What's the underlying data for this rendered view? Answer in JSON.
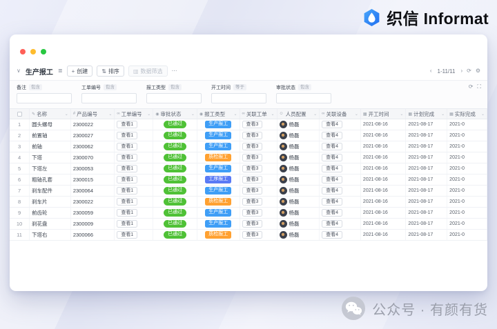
{
  "brand": {
    "name": "织信 Informat"
  },
  "watermark": {
    "text": "公众号 · 有颜有货"
  },
  "colors": {
    "green": "#4fc136",
    "blue": "#3f9ef6",
    "orange": "#ffa131",
    "blue2": "#5a7af5",
    "accent": "#2f86f6"
  },
  "icons": {
    "text": "✎",
    "number": "#",
    "link": "∞",
    "status": "◉",
    "user": "☺",
    "date": "▦"
  },
  "view": {
    "title": "生产报工",
    "toolbar": {
      "create": "创建",
      "sort": "排序",
      "filter": "数据筛选",
      "pagination": "1-11/11"
    },
    "filters": [
      {
        "label": "备注",
        "op": "包含"
      },
      {
        "label": "工单编号",
        "op": "包含"
      },
      {
        "label": "报工类型",
        "op": "包含"
      },
      {
        "label": "开工时间",
        "op": "等于"
      },
      {
        "label": "审批状态",
        "op": "包含"
      }
    ]
  },
  "table": {
    "columns": [
      {
        "key": "name",
        "label": "名称",
        "icon": "text"
      },
      {
        "key": "pno",
        "label": "产品编号",
        "icon": "number"
      },
      {
        "key": "wo",
        "label": "工单编号",
        "icon": "link"
      },
      {
        "key": "appr",
        "label": "审批状态",
        "icon": "status"
      },
      {
        "key": "type",
        "label": "报工类型",
        "icon": "status"
      },
      {
        "key": "rel",
        "label": "关联工单",
        "icon": "link"
      },
      {
        "key": "person",
        "label": "人员配置",
        "icon": "user"
      },
      {
        "key": "equip",
        "label": "关联设备",
        "icon": "link"
      },
      {
        "key": "start",
        "label": "开工时间",
        "icon": "date"
      },
      {
        "key": "plan",
        "label": "计划完成",
        "icon": "date"
      },
      {
        "key": "actual",
        "label": "实际完成",
        "icon": "date"
      }
    ],
    "rows": [
      {
        "num": 1,
        "name": "圆头螺母",
        "product_no": "2300022",
        "work_order": "查看1",
        "approval": "已通过",
        "report_type": "生产报工",
        "report_type_color": "blue",
        "related_order": "查看3",
        "person": "杨磊",
        "equipment": "查看4",
        "start": "2021-08-16",
        "planned": "2021-08-17",
        "actual": "2021-0"
      },
      {
        "num": 2,
        "name": "前置轴",
        "product_no": "2300027",
        "work_order": "查看1",
        "approval": "已通过",
        "report_type": "生产报工",
        "report_type_color": "blue",
        "related_order": "查看3",
        "person": "杨磊",
        "equipment": "查看4",
        "start": "2021-08-16",
        "planned": "2021-08-17",
        "actual": "2021-0"
      },
      {
        "num": 3,
        "name": "前轴",
        "product_no": "2300062",
        "work_order": "查看1",
        "approval": "已通过",
        "report_type": "生产报工",
        "report_type_color": "blue",
        "related_order": "查看3",
        "person": "杨磊",
        "equipment": "查看4",
        "start": "2021-08-16",
        "planned": "2021-08-17",
        "actual": "2021-0"
      },
      {
        "num": 4,
        "name": "下塔",
        "product_no": "2300070",
        "work_order": "查看1",
        "approval": "已通过",
        "report_type": "质检报工",
        "report_type_color": "orange",
        "related_order": "查看3",
        "person": "杨磊",
        "equipment": "查看4",
        "start": "2021-08-16",
        "planned": "2021-08-17",
        "actual": "2021-0"
      },
      {
        "num": 5,
        "name": "下塔左",
        "product_no": "2300053",
        "work_order": "查看1",
        "approval": "已通过",
        "report_type": "生产报工",
        "report_type_color": "blue",
        "related_order": "查看3",
        "person": "杨磊",
        "equipment": "查看4",
        "start": "2021-08-16",
        "planned": "2021-08-17",
        "actual": "2021-0"
      },
      {
        "num": 6,
        "name": "粗轴孔套",
        "product_no": "2300015",
        "work_order": "查看1",
        "approval": "已通过",
        "report_type": "工序报工",
        "report_type_color": "blue2",
        "related_order": "查看3",
        "person": "杨磊",
        "equipment": "查看4",
        "start": "2021-08-16",
        "planned": "2021-08-17",
        "actual": "2021-0"
      },
      {
        "num": 7,
        "name": "刹车配件",
        "product_no": "2300064",
        "work_order": "查看1",
        "approval": "已通过",
        "report_type": "生产报工",
        "report_type_color": "blue",
        "related_order": "查看3",
        "person": "杨磊",
        "equipment": "查看4",
        "start": "2021-08-16",
        "planned": "2021-08-17",
        "actual": "2021-0"
      },
      {
        "num": 8,
        "name": "刹车片",
        "product_no": "2300022",
        "work_order": "查看1",
        "approval": "已通过",
        "report_type": "质检报工",
        "report_type_color": "orange",
        "related_order": "查看3",
        "person": "杨磊",
        "equipment": "查看4",
        "start": "2021-08-16",
        "planned": "2021-08-17",
        "actual": "2021-0"
      },
      {
        "num": 9,
        "name": "前齿轮",
        "product_no": "2300059",
        "work_order": "查看1",
        "approval": "已通过",
        "report_type": "生产报工",
        "report_type_color": "blue",
        "related_order": "查看3",
        "person": "杨磊",
        "equipment": "查看4",
        "start": "2021-08-16",
        "planned": "2021-08-17",
        "actual": "2021-0"
      },
      {
        "num": 10,
        "name": "刹花盘",
        "product_no": "2300009",
        "work_order": "查看1",
        "approval": "已通过",
        "report_type": "生产报工",
        "report_type_color": "blue",
        "related_order": "查看3",
        "person": "杨磊",
        "equipment": "查看4",
        "start": "2021-08-16",
        "planned": "2021-08-17",
        "actual": "2021-0"
      },
      {
        "num": 11,
        "name": "下塔右",
        "product_no": "2300066",
        "work_order": "查看1",
        "approval": "已通过",
        "report_type": "质检报工",
        "report_type_color": "orange",
        "related_order": "查看3",
        "person": "杨磊",
        "equipment": "查看4",
        "start": "2021-08-16",
        "planned": "2021-08-17",
        "actual": "2021-0"
      }
    ]
  }
}
